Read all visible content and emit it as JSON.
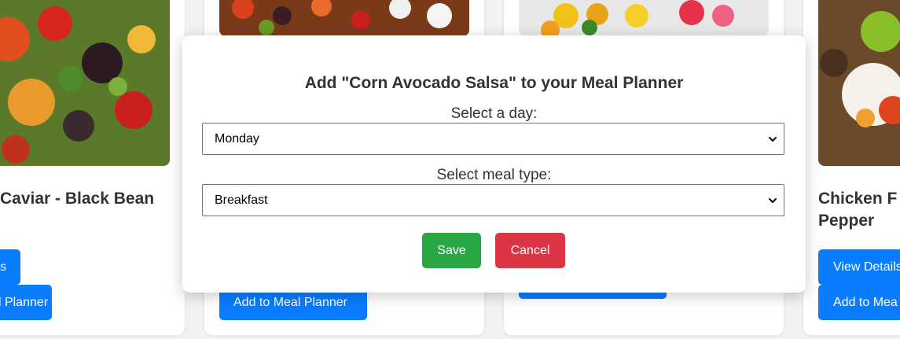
{
  "cards": [
    {
      "title": "Caviar - Black Bean",
      "view_btn": "s",
      "add_btn": "l Planner"
    },
    {
      "add_btn": "Add to Meal Planner"
    },
    {},
    {
      "title_line1": "Chicken F",
      "title_line2": "Pepper",
      "view_btn": "View Details",
      "add_btn": "Add to Mea"
    }
  ],
  "modal": {
    "title": "Add \"Corn Avocado Salsa\" to your Meal Planner",
    "day_label": "Select a day:",
    "day_value": "Monday",
    "meal_label": "Select meal type:",
    "meal_value": "Breakfast",
    "save_label": "Save",
    "cancel_label": "Cancel"
  },
  "colors": {
    "primary": "#0a7cff",
    "save": "#28a745",
    "cancel": "#dc3545"
  },
  "icons": {
    "select_arrow": "chevron-down-icon"
  }
}
